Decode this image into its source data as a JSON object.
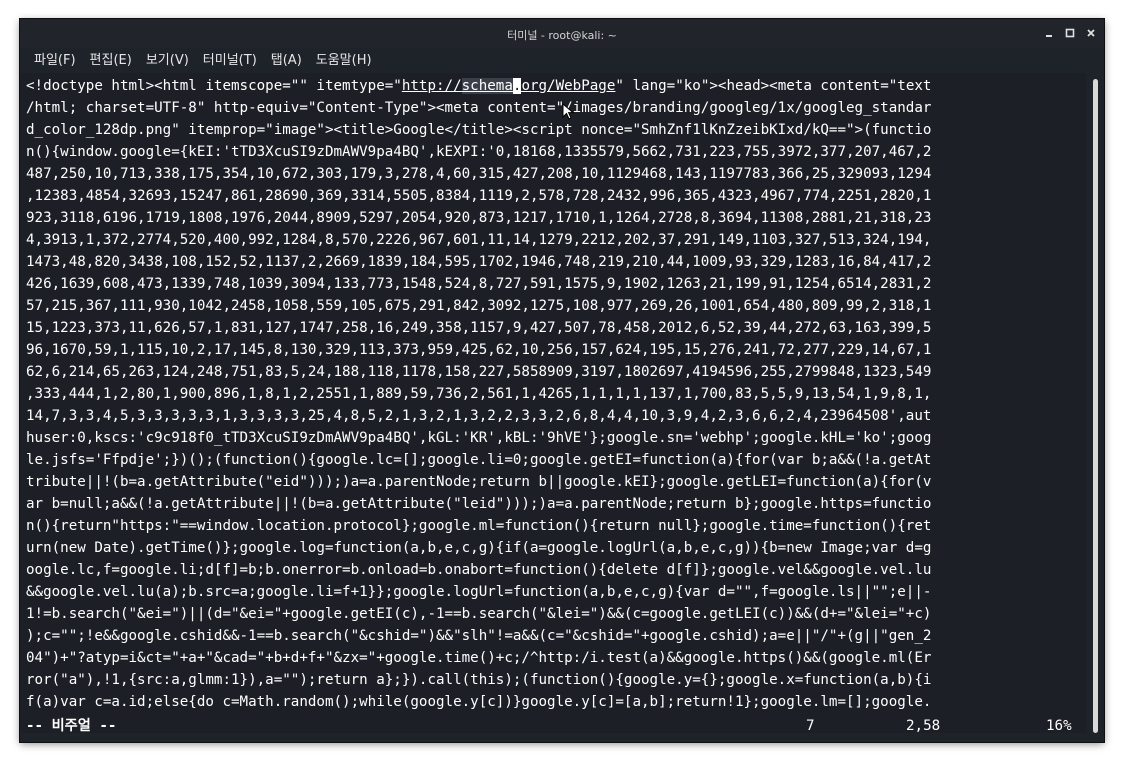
{
  "window": {
    "title": "터미널 - root@kali: ~"
  },
  "menu": [
    "파일(F)",
    "편집(E)",
    "보기(V)",
    "터미널(T)",
    "탭(A)",
    "도움말(H)"
  ],
  "terminal": {
    "line0": {
      "pre": "<!doctype html><html itemscope=\"\" itemtype=\"",
      "link_a": "http://",
      "link_sel": "schema",
      "link_cursor": ".",
      "link_b": "org/WebPage",
      "post": "\" lang=\"ko\"><head><meta content=\"text"
    },
    "lines": [
      "/html; charset=UTF-8\" http-equiv=\"Content-Type\"><meta content=\"/images/branding/googleg/1x/googleg_standar",
      "d_color_128dp.png\" itemprop=\"image\"><title>Google</title><script nonce=\"SmhZnf1lKnZzeibKIxd/kQ==\">(functio",
      "n(){window.google={kEI:'tTD3XcuSI9zDmAWV9pa4BQ',kEXPI:'0,18168,1335579,5662,731,223,755,3972,377,207,467,2",
      "487,250,10,713,338,175,354,10,672,303,179,3,278,4,60,315,427,208,10,1129468,143,1197783,366,25,329093,1294",
      ",12383,4854,32693,15247,861,28690,369,3314,5505,8384,1119,2,578,728,2432,996,365,4323,4967,774,2251,2820,1",
      "923,3118,6196,1719,1808,1976,2044,8909,5297,2054,920,873,1217,1710,1,1264,2728,8,3694,11308,2881,21,318,23",
      "4,3913,1,372,2774,520,400,992,1284,8,570,2226,967,601,11,14,1279,2212,202,37,291,149,1103,327,513,324,194,",
      "1473,48,820,3438,108,152,52,1137,2,2669,1839,184,595,1702,1946,748,219,210,44,1009,93,329,1283,16,84,417,2",
      "426,1639,608,473,1339,748,1039,3094,133,773,1548,524,8,727,591,1575,9,1902,1263,21,199,91,1254,6514,2831,2",
      "57,215,367,111,930,1042,2458,1058,559,105,675,291,842,3092,1275,108,977,269,26,1001,654,480,809,99,2,318,1",
      "15,1223,373,11,626,57,1,831,127,1747,258,16,249,358,1157,9,427,507,78,458,2012,6,52,39,44,272,63,163,399,5",
      "96,1670,59,1,115,10,2,17,145,8,130,329,113,373,959,425,62,10,256,157,624,195,15,276,241,72,277,229,14,67,1",
      "62,6,214,65,263,124,248,751,83,5,24,188,118,1178,158,227,5858909,3197,1802697,4194596,255,2799848,1323,549",
      ",333,444,1,2,80,1,900,896,1,8,1,2,2551,1,889,59,736,2,561,1,4265,1,1,1,1,137,1,700,83,5,5,9,13,54,1,9,8,1,",
      "14,7,3,3,4,5,3,3,3,3,3,1,3,3,3,3,25,4,8,5,2,1,3,2,1,3,2,2,3,3,2,6,8,4,4,10,3,9,4,2,3,6,6,2,4,23964508',aut",
      "huser:0,kscs:'c9c918f0_tTD3XcuSI9zDmAWV9pa4BQ',kGL:'KR',kBL:'9hVE'};google.sn='webhp';google.kHL='ko';goog",
      "le.jsfs='Ffpdje';})();(function(){google.lc=[];google.li=0;google.getEI=function(a){for(var b;a&&(!a.getAt",
      "tribute||!(b=a.getAttribute(\"eid\")));)a=a.parentNode;return b||google.kEI};google.getLEI=function(a){for(v",
      "ar b=null;a&&(!a.getAttribute||!(b=a.getAttribute(\"leid\")));)a=a.parentNode;return b};google.https=functio",
      "n(){return\"https:\"==window.location.protocol};google.ml=function(){return null};google.time=function(){ret",
      "urn(new Date).getTime()};google.log=function(a,b,e,c,g){if(a=google.logUrl(a,b,e,c,g)){b=new Image;var d=g",
      "oogle.lc,f=google.li;d[f]=b;b.onerror=b.onload=b.onabort=function(){delete d[f]};google.vel&&google.vel.lu",
      "&&google.vel.lu(a);b.src=a;google.li=f+1}};google.logUrl=function(a,b,e,c,g){var d=\"\",f=google.ls||\"\";e||-",
      "1!=b.search(\"&ei=\")||(d=\"&ei=\"+google.getEI(c),-1==b.search(\"&lei=\")&&(c=google.getLEI(c))&&(d+=\"&lei=\"+c)",
      ");c=\"\";!e&&google.cshid&&-1==b.search(\"&cshid=\")&&\"slh\"!=a&&(c=\"&cshid=\"+google.cshid);a=e||\"/\"+(g||\"gen_2",
      "04\")+\"?atyp=i&ct=\"+a+\"&cad=\"+b+d+f+\"&zx=\"+google.time()+c;/^http:/i.test(a)&&google.https()&&(google.ml(Er",
      "ror(\"a\"),!1,{src:a,glmm:1}),a=\"\");return a};}).call(this);(function(){google.y={};google.x=function(a,b){i",
      "f(a)var c=a.id;else{do c=Math.random();while(google.y[c])}google.y[c]=[a,b];return!1};google.lm=[];google."
    ]
  },
  "status": {
    "mode": "-- 비주얼 --",
    "count": "7",
    "position": "2,58",
    "percent": "16%"
  }
}
